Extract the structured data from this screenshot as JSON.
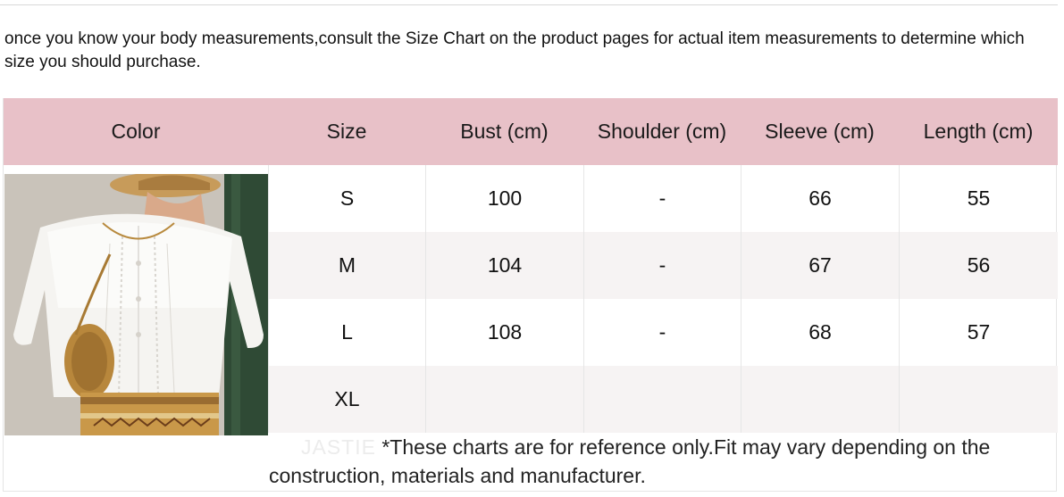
{
  "intro_text": "once you know your body measurements,consult the Size Chart on the product pages for actual item measurements to determine which size you should purchase.",
  "colors": {
    "header_background": "#e8c1c8",
    "alt_row_background": "#f6f3f3",
    "text": "#111111"
  },
  "table": {
    "headers": {
      "color": "Color",
      "size": "Size",
      "bust": "Bust (cm)",
      "shoulder": "Shoulder (cm)",
      "sleeve": "Sleeve (cm)",
      "length": "Length (cm)"
    },
    "rows": [
      {
        "size": "S",
        "bust": "100",
        "shoulder": "-",
        "sleeve": "66",
        "length": "55"
      },
      {
        "size": "M",
        "bust": "104",
        "shoulder": "-",
        "sleeve": "67",
        "length": "56"
      },
      {
        "size": "L",
        "bust": "108",
        "shoulder": "-",
        "sleeve": "68",
        "length": "57"
      },
      {
        "size": "XL",
        "bust": "",
        "shoulder": "",
        "sleeve": "",
        "length": ""
      }
    ]
  },
  "watermark": "JASTIE",
  "note": "*These charts are for reference only.Fit may vary depending on the construction, materials and manufacturer."
}
